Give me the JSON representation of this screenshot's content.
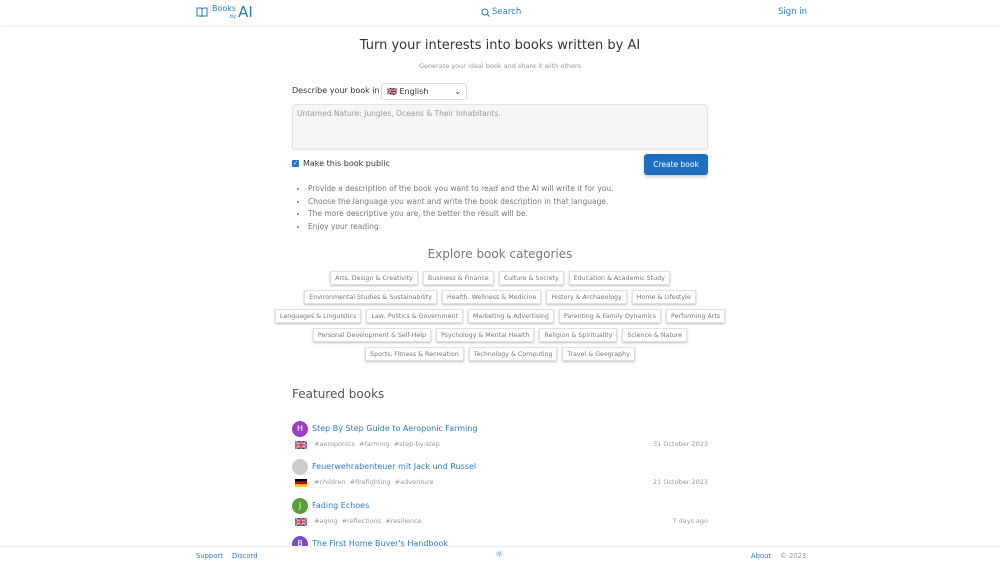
{
  "header": {
    "logo_books": "Books",
    "logo_by": "by",
    "logo_ai": "AI",
    "search": "Search",
    "signin": "Sign in"
  },
  "hero": {
    "title": "Turn your interests into books written by AI",
    "subtitle": "Generate your ideal book and share it with others"
  },
  "form": {
    "describe_label": "Describe your book in",
    "language": "🇬🇧 English",
    "placeholder": "Untamed Nature: Jungles, Oceans & Their Inhabitants.",
    "public_label": "Make this book public",
    "public_checked": true,
    "create": "Create book"
  },
  "tips": [
    "Provide a description of the book you want to read and the AI will write it for you.",
    "Choose the language you want and write the book description in that language.",
    "The more descriptive you are, the better the result will be.",
    "Enjoy your reading."
  ],
  "categories_title": "Explore book categories",
  "categories": [
    "Arts, Design & Creativity",
    "Business & Finance",
    "Culture & Society",
    "Education & Academic Study",
    "Environmental Studies & Sustainability",
    "Health, Wellness & Medicine",
    "History & Archaeology",
    "Home & Lifestyle",
    "Languages & Linguistics",
    "Law, Politics & Government",
    "Marketing & Advertising",
    "Parenting & Family Dynamics",
    "Performing Arts",
    "Personal Development & Self-Help",
    "Psychology & Mental Health",
    "Religion & Spirituality",
    "Science & Nature",
    "Sports, Fitness & Recreation",
    "Technology & Computing",
    "Travel & Geography"
  ],
  "featured_title": "Featured books",
  "books": [
    {
      "avatar": "H",
      "avatar_color": "#9b3fc4",
      "title": "Step By Step Guide to Aeroponic Farming",
      "flag": "uk",
      "tags": "#aeroponics #farming #step-by-step",
      "date": "31 October 2023"
    },
    {
      "avatar": "",
      "avatar_color": "#ccc",
      "title": "Feuerwehrabenteuer mit Jack und Russel",
      "flag": "de",
      "tags": "#children #firefighting #adventure",
      "date": "21 October 2023"
    },
    {
      "avatar": "J",
      "avatar_color": "#5a9e3a",
      "title": "Fading Echoes",
      "flag": "uk",
      "tags": "#aging #reflections #resilience",
      "date": "7 days ago"
    },
    {
      "avatar": "B",
      "avatar_color": "#7a4fc4",
      "title": "The First Home Buyer's Handbook",
      "flag": "",
      "tags": "",
      "date": ""
    }
  ],
  "footer": {
    "support": "Support",
    "discord": "Discord",
    "about": "About",
    "copyright": "© 2023"
  }
}
